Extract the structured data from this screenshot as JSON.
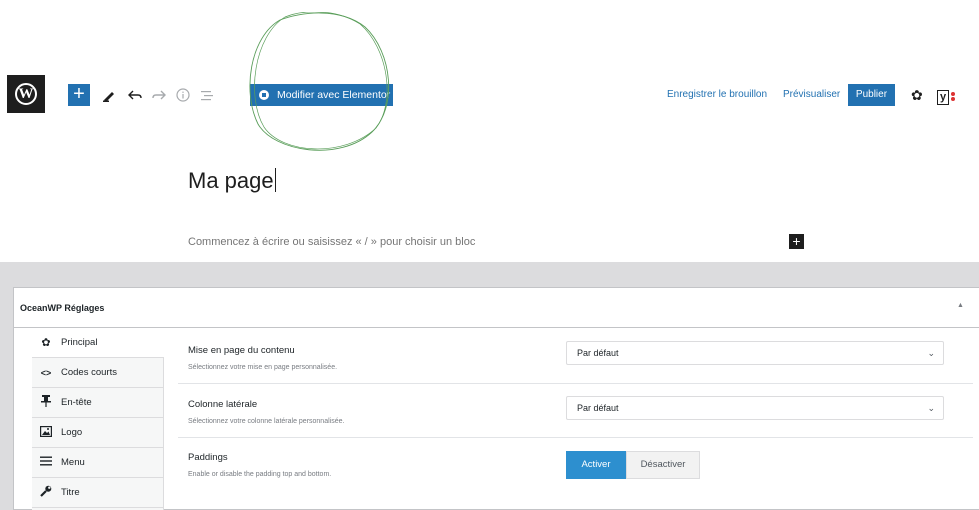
{
  "toolbar": {
    "add_label": "+",
    "elementor_label": "Modifier avec Elementor",
    "save_draft": "Enregistrer le brouillon",
    "preview": "Prévisualiser",
    "publish": "Publier",
    "icons": [
      "wordpress-logo",
      "add-block-icon",
      "pen-tool-icon",
      "undo-icon",
      "redo-icon",
      "info-icon",
      "list-view-icon",
      "gear-icon",
      "yoast-icon",
      "kebab-menu-icon"
    ]
  },
  "editor": {
    "title": "Ma page",
    "placeholder": "Commencez à écrire ou saisissez « / » pour choisir un bloc",
    "block_add": "+"
  },
  "panel": {
    "title": "OceanWP Réglages",
    "sidebar": [
      {
        "label": "Principal",
        "icon": "gear-icon",
        "active": true
      },
      {
        "label": "Codes courts",
        "icon": "code-icon"
      },
      {
        "label": "En-tête",
        "icon": "pin-icon"
      },
      {
        "label": "Logo",
        "icon": "image-icon"
      },
      {
        "label": "Menu",
        "icon": "menu-icon"
      },
      {
        "label": "Titre",
        "icon": "wrench-icon"
      }
    ],
    "settings": [
      {
        "label": "Mise en page du contenu",
        "desc": "Sélectionnez votre mise en page personnalisée.",
        "value": "Par défaut"
      },
      {
        "label": "Colonne latérale",
        "desc": "Sélectionnez votre colonne latérale personnalisée.",
        "value": "Par défaut"
      },
      {
        "label": "Paddings",
        "desc": "Enable or disable the padding top and bottom.",
        "on_label": "Activer",
        "off_label": "Désactiver"
      }
    ]
  },
  "colors": {
    "accent": "#2271b1",
    "toggle_active": "#2d8fcf"
  }
}
